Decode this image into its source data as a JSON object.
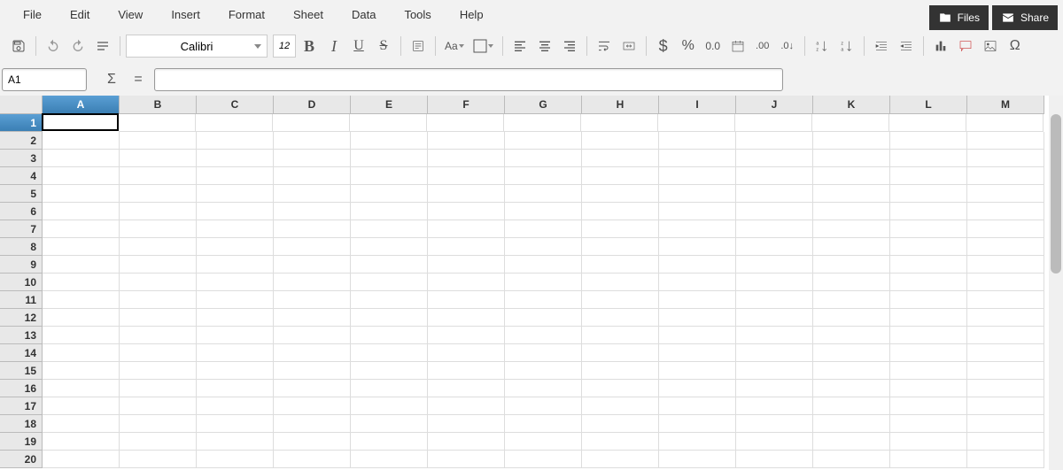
{
  "menubar": {
    "items": [
      "File",
      "Edit",
      "View",
      "Insert",
      "Format",
      "Sheet",
      "Data",
      "Tools",
      "Help"
    ]
  },
  "topright": {
    "files": "Files",
    "share": "Share"
  },
  "toolbar": {
    "font_name": "Calibri",
    "font_size": "12"
  },
  "formula": {
    "name_box": "A1",
    "input": ""
  },
  "sheet": {
    "columns": [
      "A",
      "B",
      "C",
      "D",
      "E",
      "F",
      "G",
      "H",
      "I",
      "J",
      "K",
      "L",
      "M"
    ],
    "rows": [
      "1",
      "2",
      "3",
      "4",
      "5",
      "6",
      "7",
      "8",
      "9",
      "10",
      "11",
      "12",
      "13",
      "14",
      "15",
      "16",
      "17",
      "18",
      "19",
      "20"
    ],
    "selected_cell": "A1",
    "selected_col": "A",
    "selected_row": "1"
  }
}
